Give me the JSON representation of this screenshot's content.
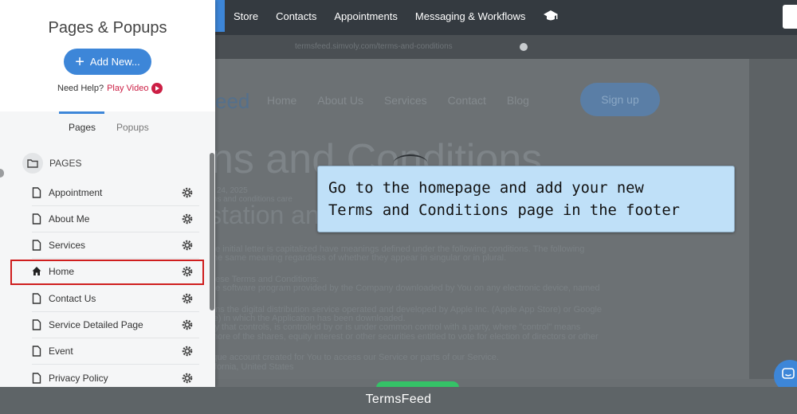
{
  "topnav": {
    "items": [
      "Store",
      "Contacts",
      "Appointments",
      "Messaging & Workflows"
    ]
  },
  "urlbar": {
    "url": "termsfeed.simvoly.com/terms-and-conditions"
  },
  "preview": {
    "logo_fragment": "eed",
    "nav": [
      "Home",
      "About Us",
      "Services",
      "Contact",
      "Blog"
    ],
    "signup": "Sign up",
    "title_fragment": "ns and Conditions",
    "date_fragment": "y 24, 2025",
    "subtitle_fragment": "station an",
    "body_lines": [
      "ms and conditions care",
      "",
      "he initial letter is capitalized have meanings defined under the following conditions. The following",
      "the same meaning regardless of whether they appear in singular or in plural.",
      "",
      "hese Terms and Conditions:",
      "he software program provided by the Company downloaded by You on any electronic device, named",
      "",
      "ans the digital distribution service operated and developed by Apple Inc. (Apple App Store) or Google",
      "re) in which the Application has been downloaded.",
      "ity that controls, is controlled by or is under common control with a party, where \"control\" means",
      " more of the shares, equity interest or other securities entitled to vote for election of directors or other",
      "",
      "ique account created for You to access our Service or parts of our Service.",
      "lifornia, United States"
    ]
  },
  "tooltip": {
    "line1": "Go to the homepage and add your new",
    "line2": "Terms and Conditions page in the footer"
  },
  "panel": {
    "title": "Pages & Popups",
    "add_new": "Add New...",
    "help_text": "Need Help?",
    "play_video": "Play Video",
    "tabs": [
      "Pages",
      "Popups"
    ],
    "section_label": "PAGES",
    "pages": [
      "Appointment",
      "About Me",
      "Services",
      "Home",
      "Contact Us",
      "Service Detailed Page",
      "Event",
      "Privacy Policy"
    ],
    "highlighted_page": "Home"
  },
  "footer": {
    "label": "TermsFeed"
  },
  "colors": {
    "accent": "#3d86d8",
    "highlight_border": "#cf1e1e",
    "tooltip_bg": "#bfe0f8"
  }
}
